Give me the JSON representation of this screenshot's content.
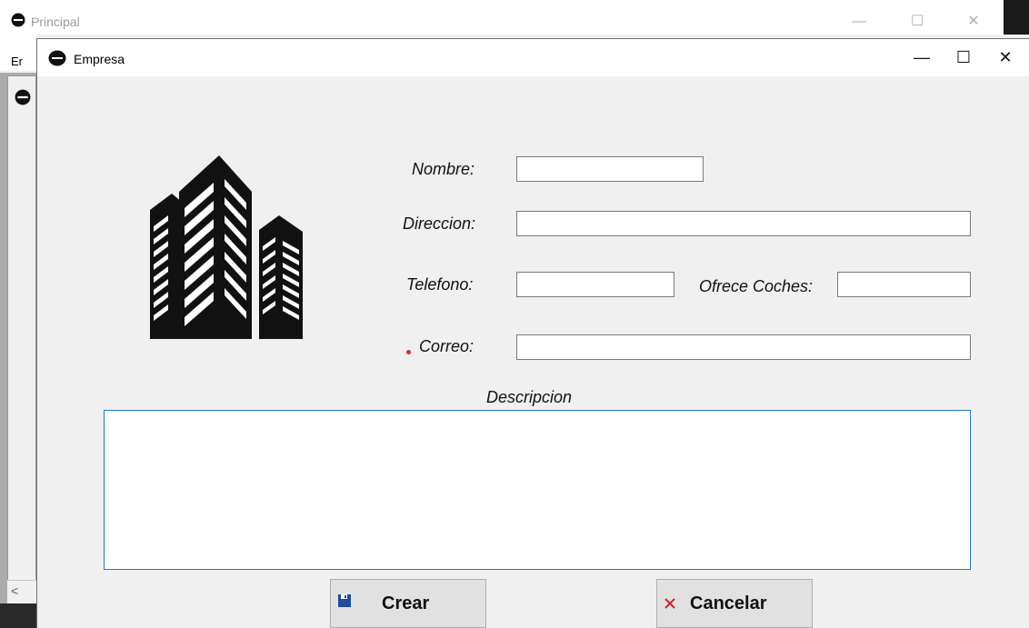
{
  "parent_window": {
    "title": "Principal",
    "menu_item_partial": "Er",
    "controls": {
      "minimize": "—",
      "maximize": "☐",
      "close": "✕"
    },
    "scroll_left_arrow": "<"
  },
  "dialog": {
    "title": "Empresa",
    "controls": {
      "minimize": "—",
      "maximize": "☐",
      "close": "✕"
    }
  },
  "form": {
    "nombre": {
      "label": "Nombre:",
      "value": ""
    },
    "direccion": {
      "label": "Direccion:",
      "value": ""
    },
    "telefono": {
      "label": "Telefono:",
      "value": ""
    },
    "ofrece_coches": {
      "label": "Ofrece Coches:",
      "value": ""
    },
    "correo": {
      "label": "Correo:",
      "value": "",
      "required": true
    },
    "descripcion": {
      "label": "Descripcion",
      "value": ""
    }
  },
  "buttons": {
    "crear": {
      "label": "Crear",
      "icon": "save-icon"
    },
    "cancelar": {
      "label": "Cancelar",
      "icon": "close-icon"
    }
  },
  "colors": {
    "required_marker": "#d32f2f",
    "focus_border": "#1a7ad4",
    "save_icon": "#1f4e9c",
    "cancel_icon": "#c62828"
  },
  "illustration": "buildings-icon"
}
